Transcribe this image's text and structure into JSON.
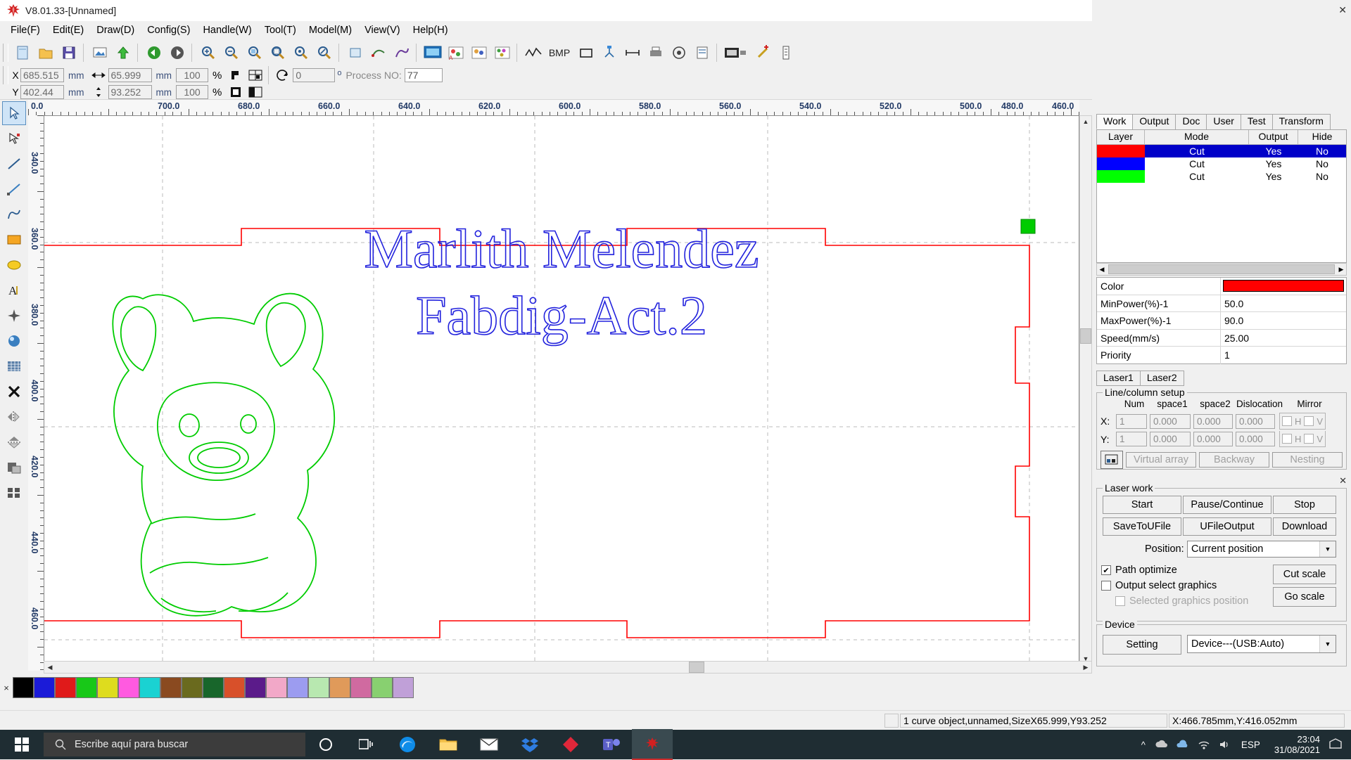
{
  "window": {
    "title": "V8.01.33-[Unnamed]",
    "app_icon": "rdworks-logo-icon",
    "minimize": "—",
    "maximize": "❐",
    "close": "✕"
  },
  "menu": [
    {
      "label": "File(F)"
    },
    {
      "label": "Edit(E)"
    },
    {
      "label": "Draw(D)"
    },
    {
      "label": "Config(S)"
    },
    {
      "label": "Handle(W)"
    },
    {
      "label": "Tool(T)"
    },
    {
      "label": "Model(M)"
    },
    {
      "label": "View(V)"
    },
    {
      "label": "Help(H)"
    }
  ],
  "toolbar_main": [
    {
      "name": "new-file-icon"
    },
    {
      "name": "open-file-icon"
    },
    {
      "name": "save-file-icon"
    },
    {
      "name": "import-image-icon"
    },
    {
      "name": "export-icon"
    },
    {
      "name": "undo-icon"
    },
    {
      "name": "redo-icon"
    },
    {
      "name": "zoom-in-icon"
    },
    {
      "name": "zoom-out-icon"
    },
    {
      "name": "zoom-selection-icon"
    },
    {
      "name": "zoom-fit-icon"
    },
    {
      "name": "zoom-all-icon"
    },
    {
      "name": "zoom-region-icon"
    },
    {
      "name": "unclosed-curve-icon"
    },
    {
      "name": "smooth-curve-icon"
    },
    {
      "name": "curve-edit-icon"
    },
    {
      "name": "preview-icon"
    },
    {
      "name": "bitmap-a-icon"
    },
    {
      "name": "bitmap-b-icon"
    },
    {
      "name": "bitmap-c-icon"
    },
    {
      "name": "cut-path-icon"
    },
    {
      "name": "bmp-label"
    },
    {
      "name": "rect-icon"
    },
    {
      "name": "node-icon"
    },
    {
      "name": "measure-icon"
    },
    {
      "name": "print-icon"
    },
    {
      "name": "camera-icon"
    },
    {
      "name": "page-setup-icon"
    },
    {
      "name": "device-icon"
    },
    {
      "name": "add-red-icon"
    },
    {
      "name": "list-icon"
    }
  ],
  "object_props": {
    "x_label": "X",
    "x_value": "685.515",
    "x_unit": "mm",
    "width_icon": "width-arrow-icon",
    "width_value": "65.999",
    "width_unit": "mm",
    "width_scale": "100",
    "pct": "%",
    "lock_icon": "lock-aspect-icon",
    "align_icon": "align-grid-icon",
    "y_label": "Y",
    "y_value": "402.44",
    "y_unit": "mm",
    "height_icon": "height-arrow-icon",
    "height_value": "93.252",
    "height_unit": "mm",
    "height_scale": "100",
    "rotate_icon": "rotate-icon",
    "angle_value": "0",
    "angle_unit": "o",
    "process_no_label": "Process NO:",
    "process_no_value": "77"
  },
  "toolbar_align": [
    {
      "name": "align-left-icon"
    },
    {
      "name": "align-right-icon"
    },
    {
      "name": "align-top-icon"
    },
    {
      "name": "align-bottom-icon"
    },
    {
      "name": "align-center-h-icon"
    },
    {
      "name": "align-center-v-icon"
    },
    {
      "name": "distribute-h-icon"
    },
    {
      "name": "distribute-v-icon"
    },
    {
      "name": "same-width-icon"
    },
    {
      "name": "same-height-icon"
    },
    {
      "name": "same-size-icon"
    },
    {
      "name": "snap-topleft-icon"
    },
    {
      "name": "snap-topright-icon"
    },
    {
      "name": "snap-bottomright-icon"
    },
    {
      "name": "snap-bottomleft-icon"
    },
    {
      "name": "snap-center-icon"
    },
    {
      "name": "group-left-icon"
    },
    {
      "name": "group-right-icon"
    },
    {
      "name": "group-top-icon"
    },
    {
      "name": "group-bottom-icon"
    }
  ],
  "left_tools": [
    {
      "name": "select-tool"
    },
    {
      "name": "node-edit-tool"
    },
    {
      "name": "line-tool"
    },
    {
      "name": "polyline-tool"
    },
    {
      "name": "bezier-tool"
    },
    {
      "name": "rectangle-tool"
    },
    {
      "name": "ellipse-tool"
    },
    {
      "name": "text-tool"
    },
    {
      "name": "star-tool"
    },
    {
      "name": "capture-tool"
    },
    {
      "name": "grid-tool"
    },
    {
      "name": "close-x-tool"
    },
    {
      "name": "mirror-h-tool"
    },
    {
      "name": "mirror-v-tool"
    },
    {
      "name": "offset-tool"
    },
    {
      "name": "array-tool"
    }
  ],
  "rulers": {
    "horizontal": [
      "0.0",
      "700.0",
      "680.0",
      "660.0",
      "640.0",
      "620.0",
      "600.0",
      "580.0",
      "560.0",
      "540.0",
      "520.0",
      "500.0",
      "480.0",
      "460.0"
    ],
    "vertical": [
      "340.0",
      "360.0",
      "380.0",
      "400.0",
      "420.0",
      "440.0",
      "460.0"
    ]
  },
  "canvas": {
    "text_line1": "Marlith Melendez",
    "text_line2": "Fabdig-Act.2",
    "text_color": "#2222dd",
    "outline_color": "#ff0000",
    "shape_color": "#00cc00",
    "selection_handle_color": "#00cc00"
  },
  "palette": {
    "close_label": "×",
    "colors": [
      "#000000",
      "#1b1bd8",
      "#e01a1a",
      "#18c818",
      "#dedc1e",
      "#ff5ae0",
      "#1ad2d2",
      "#8a4a20",
      "#6a6a1e",
      "#18662b",
      "#d8502a",
      "#5b1b8a",
      "#f2a8c8",
      "#9c9cf0",
      "#b8e8b0",
      "#e09a5a",
      "#d06aa0",
      "#88d070",
      "#c0a0d8"
    ]
  },
  "right_panel": {
    "close": "✕",
    "tabs": [
      {
        "label": "Work",
        "active": true
      },
      {
        "label": "Output",
        "active": false
      },
      {
        "label": "Doc",
        "active": false
      },
      {
        "label": "User",
        "active": false
      },
      {
        "label": "Test",
        "active": false
      },
      {
        "label": "Transform",
        "active": false
      }
    ],
    "layer_table": {
      "headers": [
        "Layer",
        "Mode",
        "Output",
        "Hide"
      ],
      "rows": [
        {
          "color": "#ff0000",
          "mode": "Cut",
          "output": "Yes",
          "hide": "No",
          "selected": true
        },
        {
          "color": "#0000ff",
          "mode": "Cut",
          "output": "Yes",
          "hide": "No",
          "selected": false
        },
        {
          "color": "#00ff00",
          "mode": "Cut",
          "output": "Yes",
          "hide": "No",
          "selected": false
        }
      ]
    },
    "params": [
      {
        "key": "Color",
        "value": "",
        "swatch": "#ff0000"
      },
      {
        "key": "MinPower(%)-1",
        "value": "50.0"
      },
      {
        "key": "MaxPower(%)-1",
        "value": "90.0"
      },
      {
        "key": "Speed(mm/s)",
        "value": "25.00"
      },
      {
        "key": "Priority",
        "value": "1"
      }
    ],
    "laser_tabs": [
      {
        "label": "Laser1"
      },
      {
        "label": "Laser2"
      }
    ],
    "line_column": {
      "title": "Line/column setup",
      "headers": [
        "Num",
        "space1",
        "space2",
        "Dislocation",
        "Mirror"
      ],
      "rows": [
        {
          "axis": "X:",
          "num": "1",
          "space1": "0.000",
          "space2": "0.000",
          "dislocation": "0.000",
          "h": "H",
          "v": "V"
        },
        {
          "axis": "Y:",
          "num": "1",
          "space1": "0.000",
          "space2": "0.000",
          "dislocation": "0.000",
          "h": "H",
          "v": "V"
        }
      ],
      "buttons": [
        {
          "label": "Virtual array"
        },
        {
          "label": "Backway"
        },
        {
          "label": "Nesting"
        }
      ]
    },
    "laser_work": {
      "title": "Laser work",
      "start": "Start",
      "pause": "Pause/Continue",
      "stop": "Stop",
      "save_to_ufile": "SaveToUFile",
      "ufile_output": "UFileOutput",
      "download": "Download",
      "position_label": "Position:",
      "position_value": "Current position",
      "path_optimize": "Path optimize",
      "output_select_graphics": "Output select graphics",
      "selected_graphics_position": "Selected graphics position",
      "cut_scale": "Cut scale",
      "go_scale": "Go scale"
    },
    "device": {
      "title": "Device",
      "setting": "Setting",
      "device_value": "Device---(USB:Auto)"
    }
  },
  "status_bar": {
    "object_info": "1 curve object,unnamed,SizeX65.999,Y93.252",
    "coords": "X:466.785mm,Y:416.052mm"
  },
  "taskbar": {
    "start_icon": "windows-start-icon",
    "search_icon": "search-icon",
    "search_placeholder": "Escribe aquí para buscar",
    "apps": [
      {
        "name": "cortana-icon"
      },
      {
        "name": "task-view-icon"
      },
      {
        "name": "edge-icon"
      },
      {
        "name": "file-explorer-icon"
      },
      {
        "name": "mail-icon"
      },
      {
        "name": "dropbox-icon"
      },
      {
        "name": "gem-icon"
      },
      {
        "name": "teams-icon"
      },
      {
        "name": "rdworks-icon",
        "active": true
      }
    ],
    "tray": [
      {
        "name": "chevron-up-icon"
      },
      {
        "name": "cloud-icon"
      },
      {
        "name": "onedrive-icon"
      },
      {
        "name": "network-icon"
      },
      {
        "name": "volume-icon"
      }
    ],
    "language": "ESP",
    "time": "23:04",
    "date": "31/08/2021",
    "notification_icon": "notification-icon"
  }
}
